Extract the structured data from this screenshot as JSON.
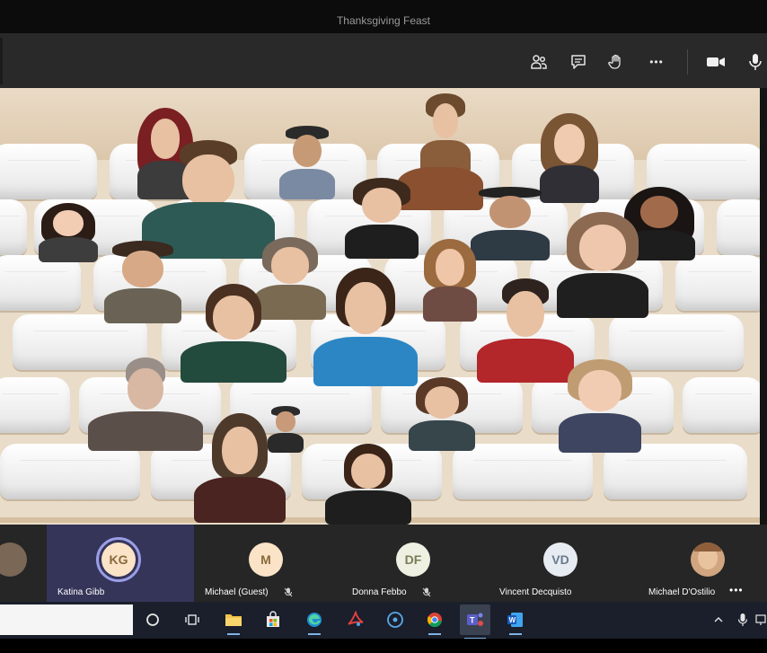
{
  "window": {
    "title": "Thanksgiving Feast"
  },
  "toolbar": {
    "icons": [
      "people-icon",
      "chat-icon",
      "raise-hand-icon",
      "more-icon",
      "camera-icon",
      "mic-icon"
    ],
    "more_glyph": "•••"
  },
  "participants": [
    {
      "name": "",
      "initials": "",
      "type": "photo"
    },
    {
      "name": "Katina Gibb",
      "initials": "KG",
      "type": "initials",
      "speaking": true,
      "muted": false
    },
    {
      "name": "Michael (Guest)",
      "initials": "M",
      "type": "initials",
      "muted": true
    },
    {
      "name": "Donna Febbo",
      "initials": "DF",
      "type": "initials",
      "muted": true
    },
    {
      "name": "Vincent Decquisto",
      "initials": "VD",
      "type": "initials",
      "muted": false
    },
    {
      "name": "Michael D'Ostilio",
      "initials": "",
      "type": "photo",
      "muted": false,
      "more": "•••"
    }
  ],
  "taskbar": {
    "apps": [
      "cortana-icon",
      "task-view-icon",
      "file-explorer-icon",
      "store-icon",
      "edge-icon",
      "acrobat-icon",
      "media-icon",
      "chrome-icon",
      "teams-icon",
      "word-icon"
    ],
    "tray": [
      "chevron-up-icon",
      "mic-icon",
      "network-icon"
    ]
  },
  "colors": {
    "titlebar": "#0c0c0c",
    "toolbar": "#292929",
    "strip": "#262626",
    "speaking_ring": "#9b9ee6",
    "taskbar": "#1a1f2b"
  }
}
